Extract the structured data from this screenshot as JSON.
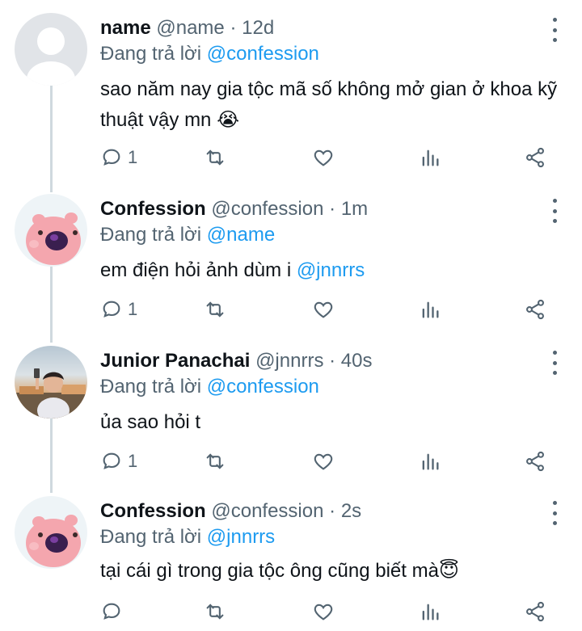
{
  "tweets": [
    {
      "name": "name",
      "handle": "@name",
      "dot": "·",
      "time": "12d",
      "reply_prefix": "Đang trả lời",
      "reply_to": "@confession",
      "text": "sao năm nay gia tộc mã số không mở gian ở khoa kỹ thuật vậy mn 😭",
      "reply_count": "1",
      "avatar_icon": "default-avatar-icon"
    },
    {
      "name": "Confession",
      "handle": "@confession",
      "dot": "·",
      "time": "1m",
      "reply_prefix": "Đang trả lời",
      "reply_to": "@name",
      "text_main": "em điện hỏi ảnh dùm i ",
      "text_mention": "@jnnrrs",
      "reply_count": "1",
      "avatar_icon": "pig-avatar-icon"
    },
    {
      "name": "Junior Panachai",
      "handle": "@jnnrrs",
      "dot": "·",
      "time": "40s",
      "reply_prefix": "Đang trả lời",
      "reply_to": "@confession",
      "text": "ủa sao hỏi t",
      "reply_count": "1",
      "avatar_icon": "photo-avatar-icon"
    },
    {
      "name": "Confession",
      "handle": "@confession",
      "dot": "·",
      "time": "2s",
      "reply_prefix": "Đang trả lời",
      "reply_to": "@jnnrrs",
      "text": "tại cái gì trong gia tộc ông cũng biết mà😇",
      "reply_count": "",
      "avatar_icon": "pig-avatar-icon"
    }
  ],
  "colors": {
    "accent": "#1d9bf0",
    "secondary_text": "#536471",
    "thread_line": "#cfd9de"
  }
}
